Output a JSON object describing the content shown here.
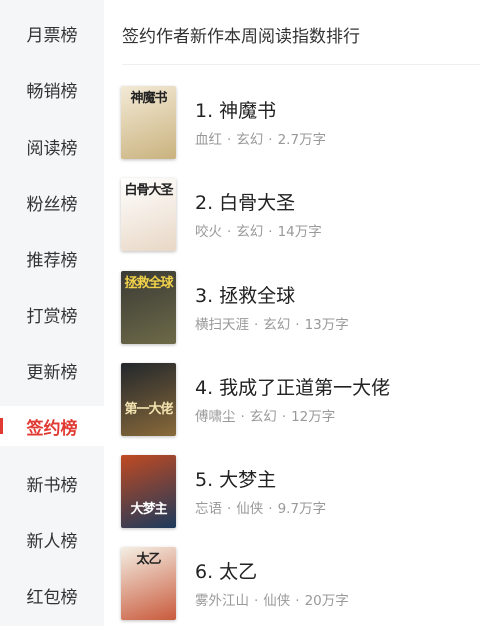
{
  "sidebar": {
    "items": [
      {
        "label": "月票榜",
        "active": false
      },
      {
        "label": "畅销榜",
        "active": false
      },
      {
        "label": "阅读榜",
        "active": false
      },
      {
        "label": "粉丝榜",
        "active": false
      },
      {
        "label": "推荐榜",
        "active": false
      },
      {
        "label": "打赏榜",
        "active": false
      },
      {
        "label": "更新榜",
        "active": false
      },
      {
        "label": "签约榜",
        "active": true
      },
      {
        "label": "新书榜",
        "active": false
      },
      {
        "label": "新人榜",
        "active": false
      },
      {
        "label": "红包榜",
        "active": false
      }
    ],
    "accent_color": "#e03a32"
  },
  "main": {
    "title": "签约作者新作本周阅读指数排行",
    "books": [
      {
        "rank_title": "1. 神魔书",
        "author": "血红",
        "genre": "玄幻",
        "words": "2.7万字",
        "cover_text": "神魔书",
        "cover_colors": [
          "#f3ead6",
          "#c9b27e"
        ]
      },
      {
        "rank_title": "2. 白骨大圣",
        "author": "咬火",
        "genre": "玄幻",
        "words": "14万字",
        "cover_text": "白骨大圣",
        "cover_colors": [
          "#ffffff",
          "#e8d7c5"
        ]
      },
      {
        "rank_title": "3. 拯救全球",
        "author": "横扫天涯",
        "genre": "玄幻",
        "words": "13万字",
        "cover_text": "拯救全球",
        "cover_colors": [
          "#3a3a35",
          "#6d6a48"
        ]
      },
      {
        "rank_title": "4. 我成了正道第一大佬",
        "author": "傅啸尘",
        "genre": "玄幻",
        "words": "12万字",
        "cover_text": "第一大佬",
        "cover_colors": [
          "#22272c",
          "#8a6a3a"
        ]
      },
      {
        "rank_title": "5. 大梦主",
        "author": "忘语",
        "genre": "仙侠",
        "words": "9.7万字",
        "cover_text": "大梦主",
        "cover_colors": [
          "#c04a22",
          "#1c3a5c"
        ]
      },
      {
        "rank_title": "6. 太乙",
        "author": "雾外江山",
        "genre": "仙侠",
        "words": "20万字",
        "cover_text": "太乙",
        "cover_colors": [
          "#f4efe4",
          "#c95a3c"
        ]
      }
    ]
  }
}
